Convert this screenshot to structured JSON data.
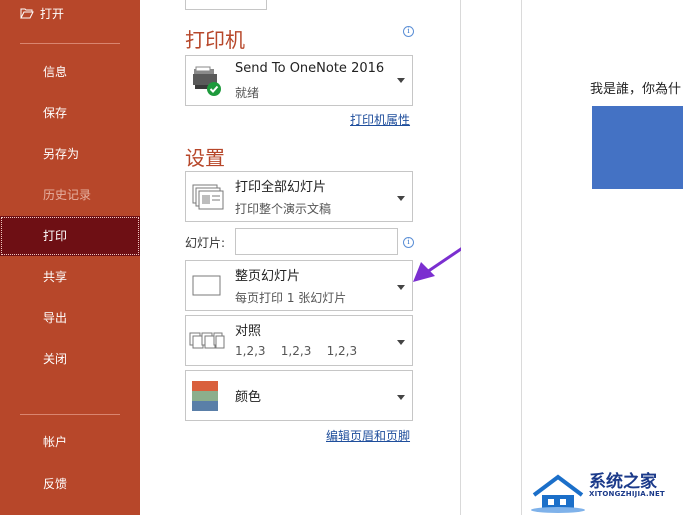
{
  "sidebar": {
    "open_label": "打开",
    "items": [
      {
        "label": "信息"
      },
      {
        "label": "保存"
      },
      {
        "label": "另存为"
      },
      {
        "label": "历史记录"
      },
      {
        "label": "打印"
      },
      {
        "label": "共享"
      },
      {
        "label": "导出"
      },
      {
        "label": "关闭"
      }
    ],
    "bottom_items": [
      {
        "label": "帐户"
      },
      {
        "label": "反馈"
      }
    ],
    "active": "打印",
    "colors": {
      "background": "#b7472a",
      "active": "#6e0f14"
    }
  },
  "printer": {
    "section_title": "打印机",
    "name": "Send To OneNote 2016",
    "status": "就绪",
    "properties_link": "打印机属性",
    "icon": "printer-ready-icon"
  },
  "settings": {
    "section_title": "设置",
    "range": {
      "line1": "打印全部幻灯片",
      "line2": "打印整个演示文稿",
      "icon": "slides-range-icon"
    },
    "slides_label": "幻灯片:",
    "slides_value": "",
    "layout": {
      "line1": "整页幻灯片",
      "line2": "每页打印 1 张幻灯片",
      "icon": "full-page-slide-icon"
    },
    "collation": {
      "line1": "对照",
      "line2": "1,2,3    1,2,3    1,2,3",
      "icon": "collate-icon"
    },
    "color": {
      "line1": "颜色",
      "icon": "color-swatch-icon"
    },
    "header_footer_link": "编辑页眉和页脚"
  },
  "preview": {
    "slide_text": "我是誰，你為什",
    "shape_color": "#4472c4"
  },
  "watermark": {
    "title": "系统之家",
    "subtitle": "XITONGZHIJIA.NET"
  },
  "annotation": {
    "arrow_color": "#7b2fd0"
  }
}
